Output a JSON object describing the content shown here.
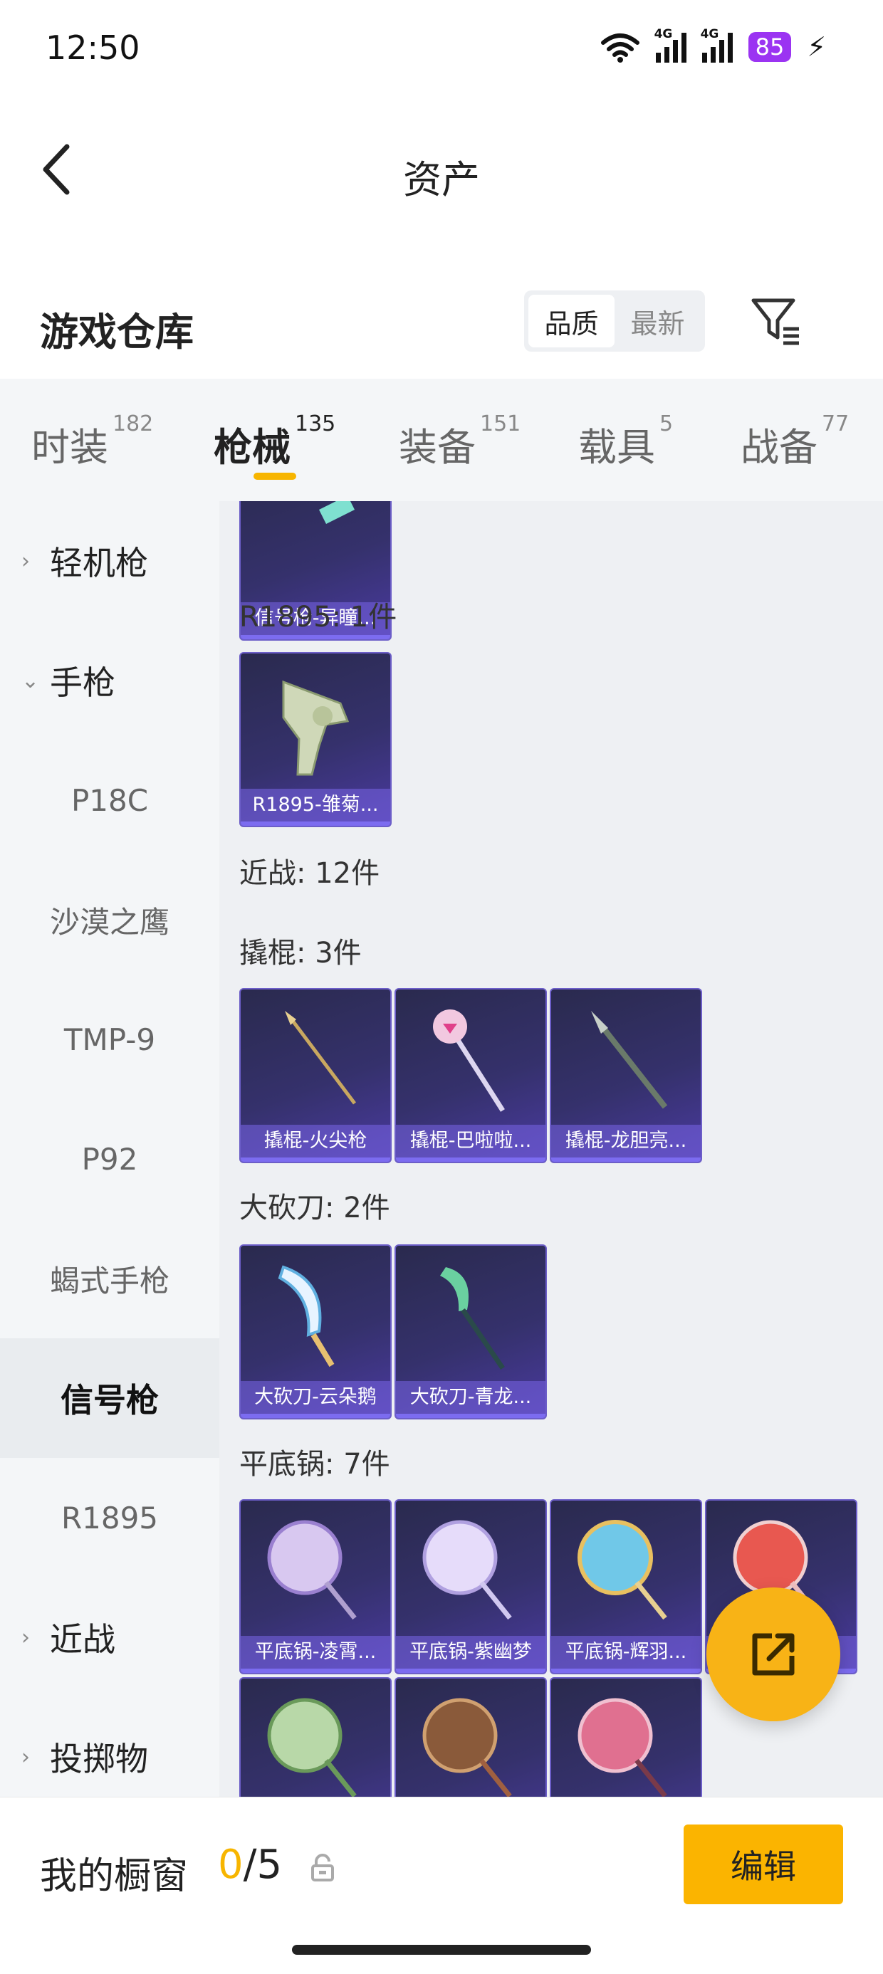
{
  "status_bar": {
    "time": "12:50",
    "battery": "85",
    "net1": "4G",
    "net2": "4G"
  },
  "nav": {
    "title": "资产",
    "back_icon": "chevron-left-icon"
  },
  "header": {
    "title": "游戏仓库",
    "sort_options": [
      "品质",
      "最新"
    ],
    "active_sort": "品质",
    "filter_icon": "filter-icon"
  },
  "tabs": [
    {
      "label": "时装",
      "count": "182"
    },
    {
      "label": "枪械",
      "count": "135",
      "active": true
    },
    {
      "label": "装备",
      "count": "151"
    },
    {
      "label": "载具",
      "count": "5"
    },
    {
      "label": "战备",
      "count": "77"
    }
  ],
  "sidebar": {
    "items": [
      {
        "label": "轻机枪",
        "type": "group",
        "expanded": false
      },
      {
        "label": "手枪",
        "type": "group",
        "expanded": true
      },
      {
        "label": "P18C",
        "type": "sub"
      },
      {
        "label": "沙漠之鹰",
        "type": "sub"
      },
      {
        "label": "TMP-9",
        "type": "sub"
      },
      {
        "label": "P92",
        "type": "sub"
      },
      {
        "label": "蝎式手枪",
        "type": "sub"
      },
      {
        "label": "信号枪",
        "type": "sub",
        "active": true
      },
      {
        "label": "R1895",
        "type": "sub"
      },
      {
        "label": "近战",
        "type": "group",
        "expanded": false
      },
      {
        "label": "投掷物",
        "type": "group",
        "expanded": false
      }
    ]
  },
  "content": {
    "sections": [
      {
        "label": "R1895: 1件"
      },
      {
        "label": "近战: 12件"
      },
      {
        "label": "撬棍: 3件"
      },
      {
        "label": "大砍刀: 2件"
      },
      {
        "label": "平底锅: 7件"
      }
    ],
    "items": [
      {
        "name": "信号枪-异瞳..."
      },
      {
        "name": "R1895-雏菊..."
      },
      {
        "name": "撬棍-火尖枪"
      },
      {
        "name": "撬棍-巴啦啦..."
      },
      {
        "name": "撬棍-龙胆亮..."
      },
      {
        "name": "大砍刀-云朵鹅"
      },
      {
        "name": "大砍刀-青龙..."
      },
      {
        "name": "平底锅-凌霄..."
      },
      {
        "name": "平底锅-紫幽梦"
      },
      {
        "name": "平底锅-辉羽..."
      },
      {
        "name": ""
      },
      {
        "name": ""
      },
      {
        "name": ""
      },
      {
        "name": ""
      }
    ]
  },
  "fab": {
    "icon": "share-icon"
  },
  "bottom": {
    "showcase_label": "我的橱窗",
    "current": "0",
    "total": "/5",
    "lock_icon": "lock-icon",
    "edit_label": "编辑"
  },
  "colors": {
    "accent": "#f7b500",
    "card": "#35316c",
    "battery": "#9b34f2"
  }
}
